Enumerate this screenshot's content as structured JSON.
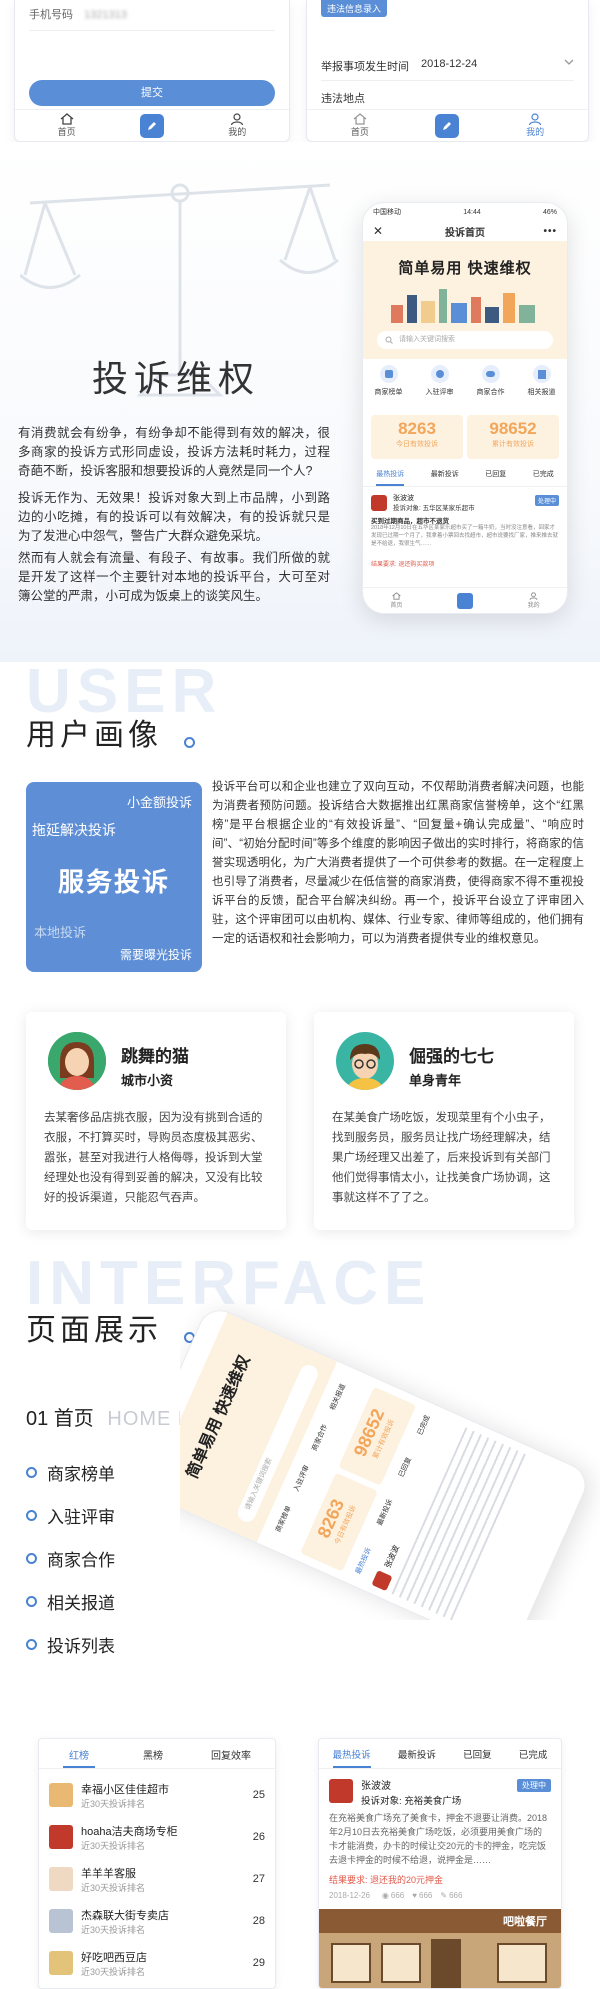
{
  "top_left": {
    "phone_label": "手机号码",
    "phone_value": "1321313",
    "submit": "提交",
    "tabs": [
      "首页",
      "我的"
    ]
  },
  "top_right": {
    "chip": "违法信息录入",
    "date_label": "举报事项发生时间",
    "date_value": "2018-12-24",
    "place_label": "违法地点",
    "tabs": [
      "首页",
      "我的"
    ]
  },
  "section1": {
    "title": "投诉维权",
    "paragraphs": [
      "有消费就会有纷争，有纷争却不能得到有效的解决，很多商家的投诉方式形同虚设，投诉方法耗时耗力，过程奇葩不断，投诉客服和想要投诉的人竟然是同一个人?",
      "投诉无作为、无效果！投诉对象大到上市品牌，小到路边的小吃摊，有的投诉可以有效解决，有的投诉就只是为了发泄心中怨气，警告广大群众避免采坑。",
      "然而有人就会有流量、有段子、有故事。我们所做的就是开发了这样一个主要针对本地的投诉平台，大可至对簿公堂的严肃，小可成为饭桌上的谈笑风生。"
    ]
  },
  "phone1": {
    "carrier": "中国移动",
    "time": "14:44",
    "battery": "46%",
    "title": "投诉首页",
    "banner": "简单易用 快速维权",
    "search_placeholder": "请输入关键词搜索",
    "quick": [
      "商家榜单",
      "入驻评审",
      "商家合作",
      "相关报道"
    ],
    "stat1_value": "8263",
    "stat1_label": "今日有效投诉",
    "stat2_value": "98652",
    "stat2_label": "累计有效投诉",
    "tabs": [
      "最热投诉",
      "最新投诉",
      "已回复",
      "已完成"
    ],
    "item_name": "张波波",
    "item_target": "投诉对象: 五华区某家乐超市",
    "item_badge": "处理中",
    "item_sub": "买到过期商品，超市不退货",
    "item_text": "2018年12月10日在五华区某家乐超市买了一箱牛奶，当时没注意看，回家才发现已过期一个月了，我拿着小票回去找超市，超市说要找厂家，推来推去就是不给退，我很生气……",
    "item_req": "结果要求: 退还购买款项",
    "nav": [
      "首页",
      "我的"
    ]
  },
  "section2": {
    "ghost": "USER",
    "title": "用户画像",
    "card_tags": [
      "小金额投诉",
      "拖延解决投诉",
      "本地投诉",
      "需要曝光投诉"
    ],
    "card_main": "服务投诉",
    "paragraph": "投诉平台可以和企业也建立了双向互动，不仅帮助消费者解决问题，也能为消费者预防问题。投诉结合大数据推出红黑商家信誉榜单，这个“红黑榜”是平台根据企业的“有效投诉量”、“回复量+确认完成量”、“响应时间”、“初始分配时间”等多个维度的影响因子做出的实时排行，将商家的信誉实现透明化，为广大消费者提供了一个可供参考的数据。在一定程度上也引导了消费者，尽量减少在低信誉的商家消费，使得商家不得不重视投诉平台的反馈，配合平台解决纠纷。再一个，投诉平台设立了评审团入驻，这个评审团可以由机构、媒体、行业专家、律师等组成的，他们拥有一定的话语权和社会影响力，可以为消费者提供专业的维权意见。"
  },
  "personas": [
    {
      "name": "跳舞的猫",
      "role": "城市小资",
      "text": "去某奢侈品店挑衣服，因为没有挑到合适的衣服，不打算买时，导购员态度极其恶劣、嚣张，甚至对我进行人格侮辱，投诉到大堂经理处也没有得到妥善的解决，又没有比较好的投诉渠道，只能忍气吞声。"
    },
    {
      "name": "倔强的七七",
      "role": "单身青年",
      "text": "在某美食广场吃饭，发现菜里有个小虫子，找到服务员，服务员让找广场经理解决，结果广场经理又出差了，后来投诉到有关部门他们觉得事情太小，让找美食广场协调，这事就这样不了了之。"
    }
  ],
  "section3": {
    "ghost": "INTERFACE",
    "title": "页面展示",
    "subtitle_num": "01 首页",
    "subtitle_en": "HOME PAGE",
    "list": [
      "商家榜单",
      "入驻评审",
      "商家合作",
      "相关报道",
      "投诉列表"
    ]
  },
  "phone2": {
    "banner": "简单易用 快速维权",
    "search_placeholder": "请输入关键词搜索",
    "stat1_value": "8263",
    "stat1_label": "今日有效投诉",
    "stat2_value": "98652",
    "stat2_label": "累计有效投诉",
    "quick": [
      "商家榜单",
      "入驻评审",
      "商家合作",
      "相关报道"
    ],
    "tabs": [
      "最热投诉",
      "最新投诉",
      "已回复",
      "已完成"
    ],
    "item_name": "张波波"
  },
  "rank_card": {
    "tabs": [
      "红榜",
      "黑榜",
      "回复效率"
    ],
    "rows": [
      {
        "name": "幸福小区佳佳超市",
        "sub": "近30天投诉排名",
        "num": "25"
      },
      {
        "name": "hoaha洁夫商场专柜",
        "sub": "近30天投诉排名",
        "num": "26"
      },
      {
        "name": "羊羊羊客服",
        "sub": "近30天投诉排名",
        "num": "27"
      },
      {
        "name": "杰森联大街专卖店",
        "sub": "近30天投诉排名",
        "num": "28"
      },
      {
        "name": "好吃吧西豆店",
        "sub": "近30天投诉排名",
        "num": "29"
      }
    ]
  },
  "complaint_card": {
    "tabs": [
      "最热投诉",
      "最新投诉",
      "已回复",
      "已完成"
    ],
    "name": "张波波",
    "badge": "处理中",
    "target": "投诉对象: 充裕美食广场",
    "text": "在充裕美食广场充了美食卡，押金不退要让消费。2018年2月10日去充裕美食广场吃饭，必须要用美食广场的卡才能消费，办卡的时候让交20元的卡的押金，吃完饭去退卡押金的时候不给退，说押金是……",
    "req": "结果要求: 退还我的20元押金",
    "date": "2018-12-26",
    "views": "666",
    "likes": "666",
    "comments": "666",
    "shop_sign": "吧啦餐厅"
  }
}
